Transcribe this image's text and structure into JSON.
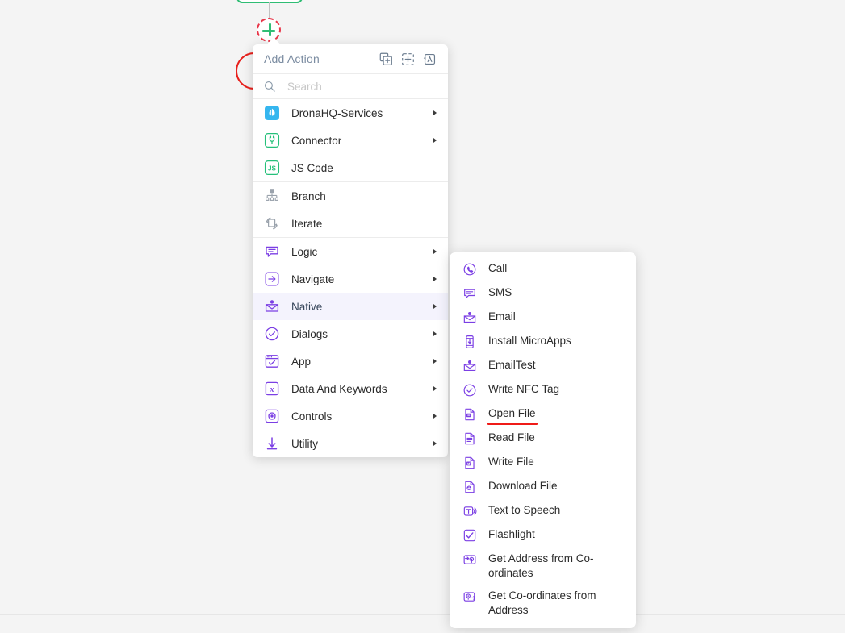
{
  "canvas": {
    "add_node_tooltip": "Add step",
    "colors": {
      "background": "#f4f4f4",
      "node_green": "#2fbd74",
      "annotation_red": "#e8201c",
      "accent_purple": "#7b3fe4",
      "highlight_bg": "#f4f3fd"
    }
  },
  "popup": {
    "title": "Add Action",
    "header_icons": [
      {
        "name": "duplicate-add-icon",
        "label": "Duplicate"
      },
      {
        "name": "move-add-icon",
        "label": "Insert"
      },
      {
        "name": "paste-text-icon",
        "label": "Paste"
      }
    ],
    "search": {
      "value": "",
      "placeholder": "Search"
    },
    "groups": [
      {
        "items": [
          {
            "label": "DronaHQ-Services",
            "icon": "dronahq-icon",
            "has_submenu": true,
            "active": false
          },
          {
            "label": "Connector",
            "icon": "connector-plug-icon",
            "has_submenu": true,
            "active": false
          },
          {
            "label": "JS Code",
            "icon": "js-code-icon",
            "has_submenu": false,
            "active": false
          }
        ]
      },
      {
        "items": [
          {
            "label": "Branch",
            "icon": "branch-icon",
            "has_submenu": false,
            "active": false
          },
          {
            "label": "Iterate",
            "icon": "iterate-icon",
            "has_submenu": false,
            "active": false
          }
        ]
      },
      {
        "items": [
          {
            "label": "Logic",
            "icon": "logic-icon",
            "has_submenu": true,
            "active": false
          },
          {
            "label": "Navigate",
            "icon": "navigate-icon",
            "has_submenu": true,
            "active": false
          },
          {
            "label": "Native",
            "icon": "native-mail-icon",
            "has_submenu": true,
            "active": true
          },
          {
            "label": "Dialogs",
            "icon": "dialogs-icon",
            "has_submenu": true,
            "active": false
          },
          {
            "label": "App",
            "icon": "app-icon",
            "has_submenu": true,
            "active": false
          },
          {
            "label": "Data And Keywords",
            "icon": "data-keywords-icon",
            "has_submenu": true,
            "active": false
          },
          {
            "label": "Controls",
            "icon": "controls-icon",
            "has_submenu": true,
            "active": false
          },
          {
            "label": "Utility",
            "icon": "utility-icon",
            "has_submenu": true,
            "active": false
          }
        ]
      }
    ]
  },
  "submenu": {
    "parent": "Native",
    "items": [
      {
        "label": "Call",
        "icon": "phone-icon",
        "highlighted": false
      },
      {
        "label": "SMS",
        "icon": "sms-icon",
        "highlighted": false
      },
      {
        "label": "Email",
        "icon": "email-icon",
        "highlighted": false
      },
      {
        "label": "Install MicroApps",
        "icon": "install-app-icon",
        "highlighted": false
      },
      {
        "label": "EmailTest",
        "icon": "email-icon",
        "highlighted": false
      },
      {
        "label": "Write NFC Tag",
        "icon": "nfc-check-icon",
        "highlighted": false
      },
      {
        "label": "Open File",
        "icon": "open-file-icon",
        "highlighted": true
      },
      {
        "label": "Read File",
        "icon": "read-file-icon",
        "highlighted": false
      },
      {
        "label": "Write File",
        "icon": "write-file-icon",
        "highlighted": false
      },
      {
        "label": "Download File",
        "icon": "download-file-icon",
        "highlighted": false
      },
      {
        "label": "Text to Speech",
        "icon": "text-speech-icon",
        "highlighted": false
      },
      {
        "label": "Flashlight",
        "icon": "flashlight-icon",
        "highlighted": false
      },
      {
        "label": "Get Address from Co-ordinates",
        "icon": "address-pin-icon",
        "highlighted": false
      },
      {
        "label": "Get Co-ordinates from Address",
        "icon": "pin-address-icon",
        "highlighted": false
      }
    ]
  }
}
